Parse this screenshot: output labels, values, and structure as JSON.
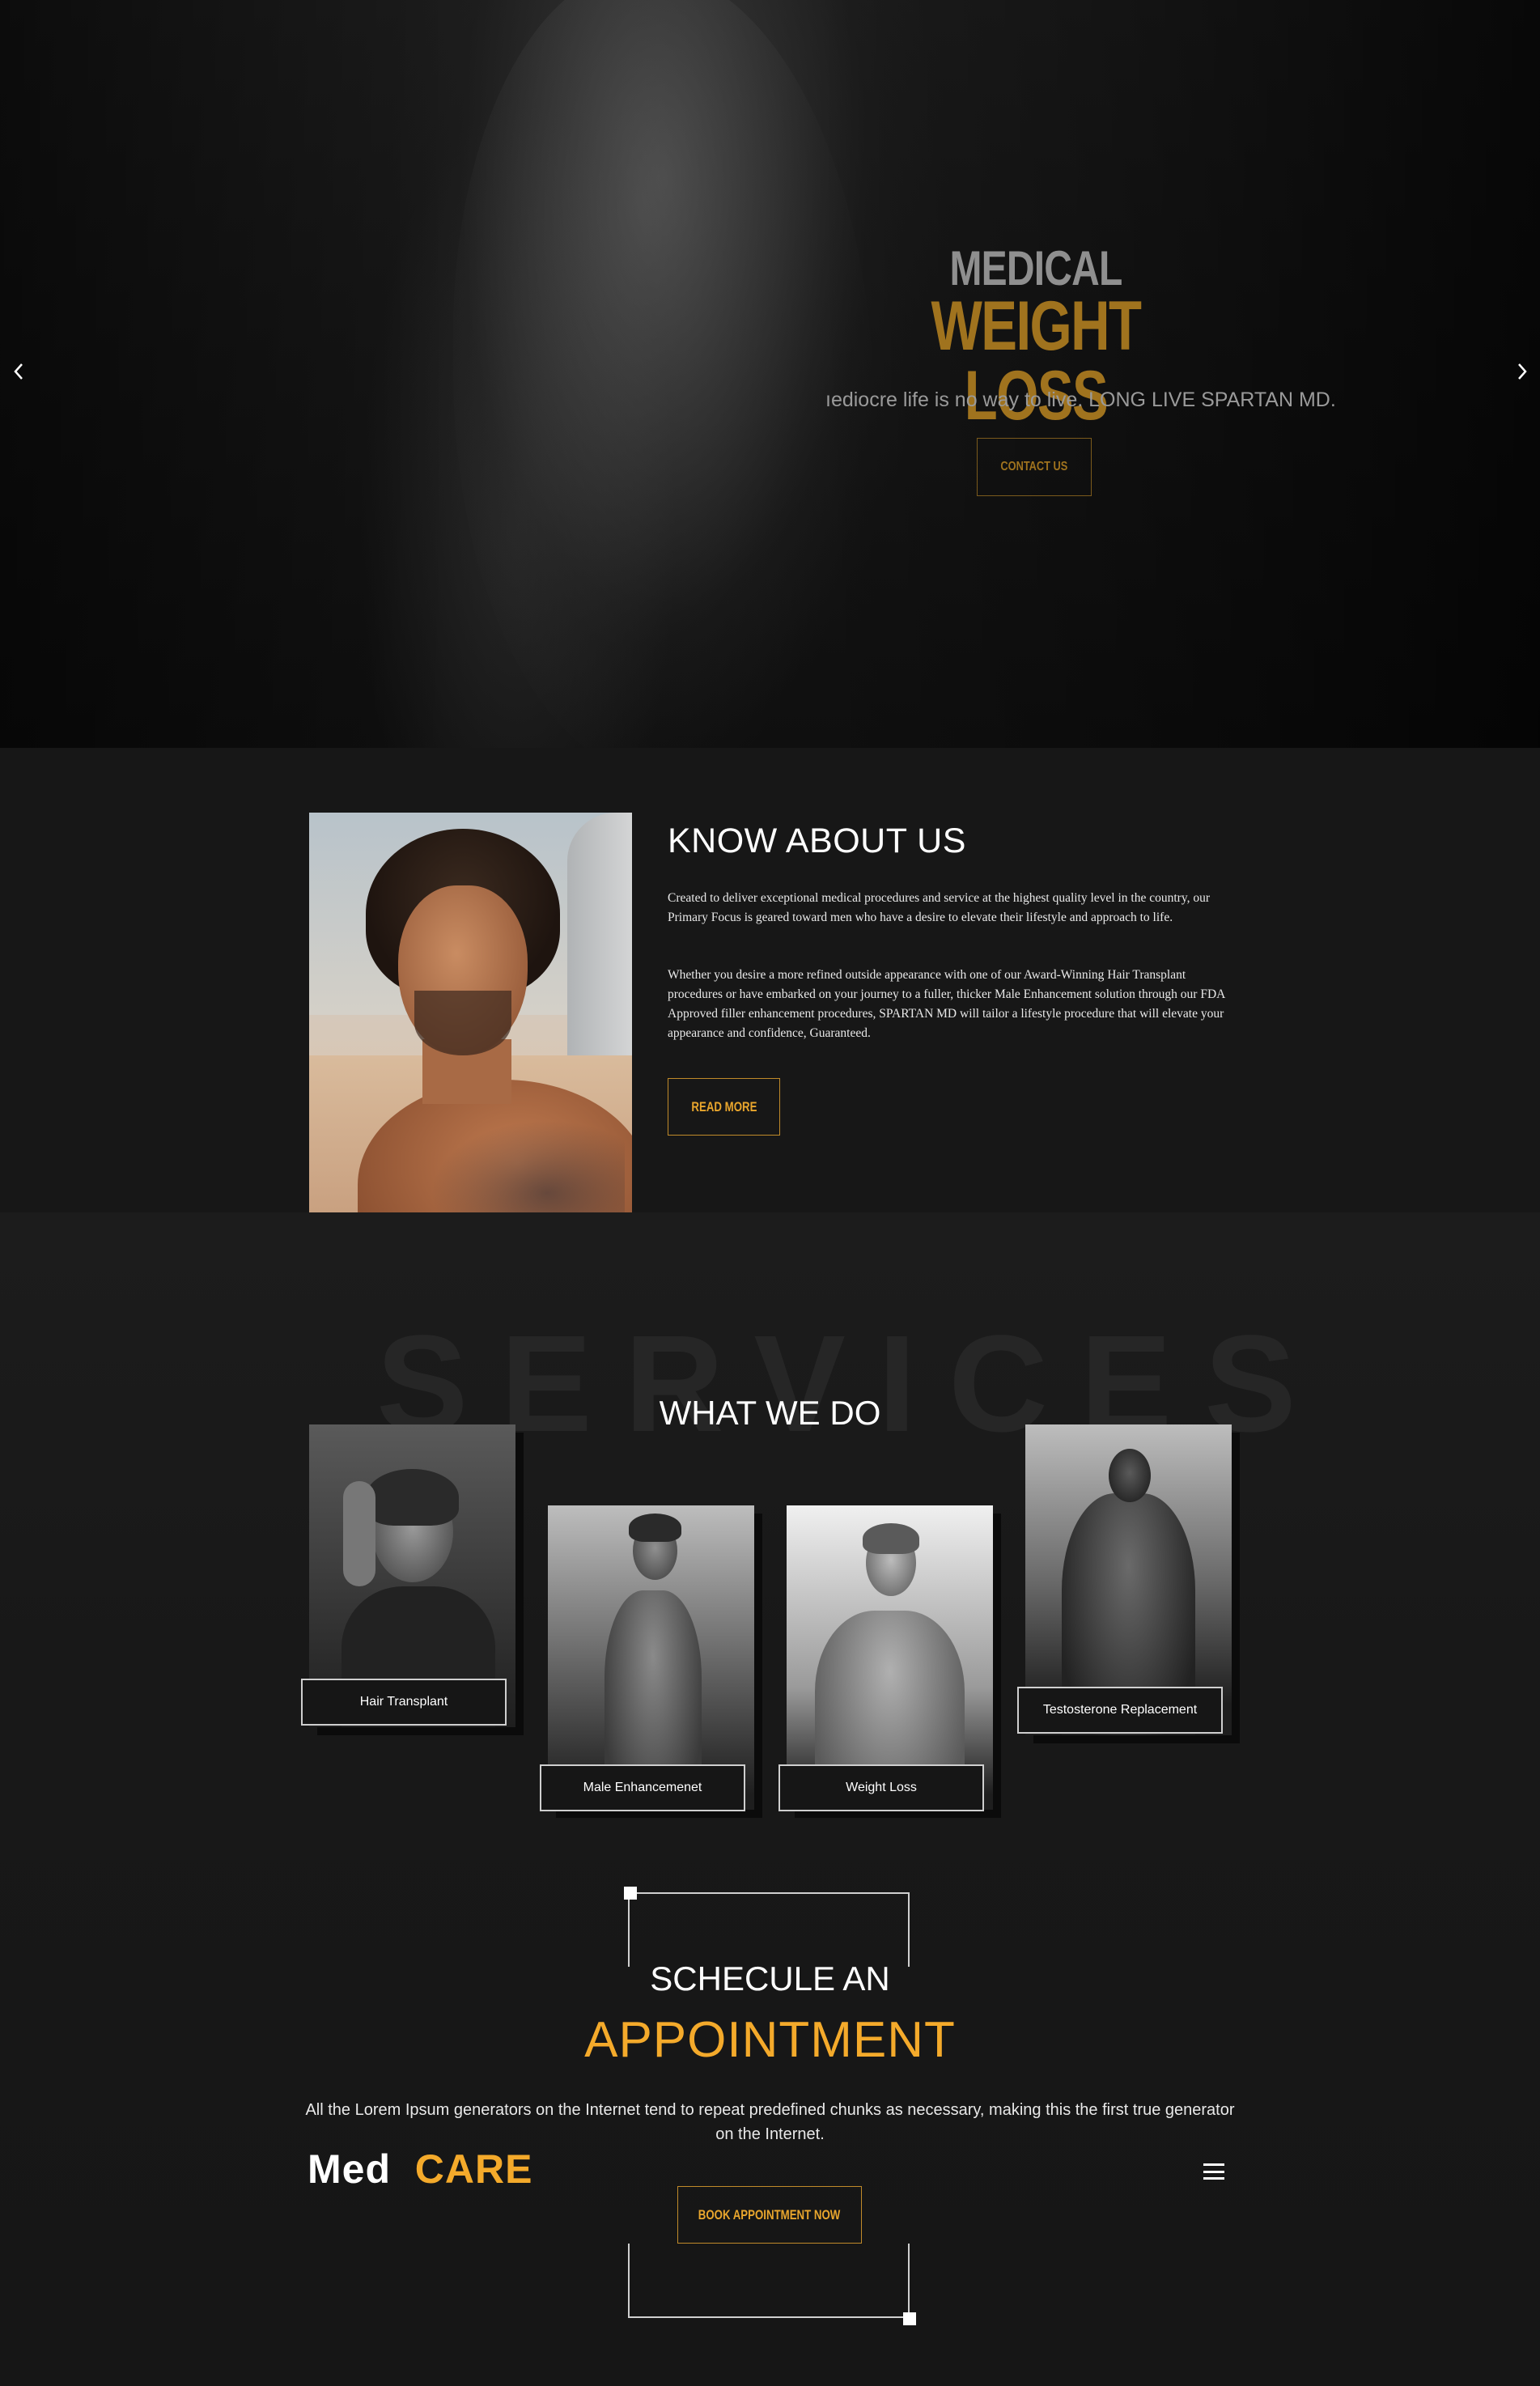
{
  "hero": {
    "sup_title": "MEDICAL",
    "title": "WEIGHT LOSS",
    "tagline": "ıediocre life is no way to live. LONG LIVE SPARTAN MD.",
    "cta_label": "CONTACT US",
    "prev_icon": "chevron-left-icon",
    "next_icon": "chevron-right-icon",
    "title_color": "#a0731e"
  },
  "about": {
    "title": "KNOW ABOUT US",
    "paragraph1": "Created to deliver exceptional medical procedures and service at the highest quality level in the country, our Primary Focus is geared toward men who have a desire to elevate their lifestyle and approach to life.",
    "paragraph2": "Whether you desire a more refined outside appearance with one of our Award-Winning Hair Transplant procedures or have embarked on your journey to a fuller, thicker Male Enhancement solution through our FDA Approved filler enhancement procedures, SPARTAN MD will tailor a lifestyle procedure that will elevate your appearance and confidence, Guaranteed.",
    "button_label": "READ MORE",
    "accent_color": "#e9a62d"
  },
  "services": {
    "watermark": "SERVICES",
    "title": "WHAT WE DO",
    "cards": [
      {
        "label": "Hair Transplant"
      },
      {
        "label": "Male Enhancemenet"
      },
      {
        "label": "Weight Loss"
      },
      {
        "label": "Testosterone Replacement"
      }
    ]
  },
  "appointment": {
    "subtitle": "SCHECULE AN",
    "title": "APPOINTMENT",
    "text": "All the Lorem Ipsum generators on the Internet tend to repeat predefined chunks as necessary, making this the first true generator on the Internet.",
    "button_label": "BOOK APPOINTMENT NOW",
    "accent_color": "#f4aa2b"
  },
  "footer_nav": {
    "logo_word1": "Med",
    "logo_word2": "CARE",
    "menu_icon": "hamburger-menu-icon"
  }
}
